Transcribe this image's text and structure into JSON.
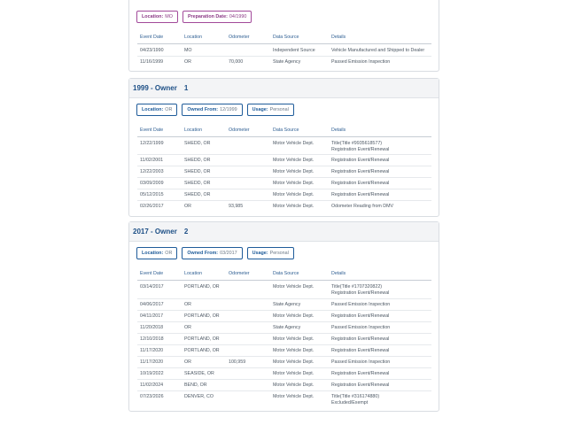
{
  "sections": [
    {
      "title": "",
      "owner": "",
      "chips": [
        {
          "label": "Location:",
          "value": "MO"
        },
        {
          "label": "Preparation Date:",
          "value": "04/1990"
        }
      ],
      "columns": [
        "Event Date",
        "Location",
        "Odometer",
        "Data Source",
        "Details"
      ],
      "rows": [
        {
          "date": "04/23/1990",
          "location": "MO",
          "odometer": "",
          "source": "Independent Source",
          "details": "Vehicle Manufactured and Shipped to Dealer"
        },
        {
          "date": "11/16/1999",
          "location": "OR",
          "odometer": "70,000",
          "source": "State Agency",
          "details": "Passed Emission Inspection"
        }
      ]
    },
    {
      "title": "1999 - Owner",
      "owner": "1",
      "chips": [
        {
          "label": "Location:",
          "value": "OR"
        },
        {
          "label": "Owned From:",
          "value": "12/1999"
        },
        {
          "label": "Usage:",
          "value": "Personal"
        }
      ],
      "columns": [
        "Event Date",
        "Location",
        "Odometer",
        "Data Source",
        "Details"
      ],
      "rows": [
        {
          "date": "12/22/1999",
          "location": "SHEDD, OR",
          "odometer": "",
          "source": "Motor Vehicle Dept.",
          "details": "Title(Title #9935618577)",
          "details2": "Registration Event/Renewal"
        },
        {
          "date": "11/02/2001",
          "location": "SHEDD, OR",
          "odometer": "",
          "source": "Motor Vehicle Dept.",
          "details": "Registration Event/Renewal"
        },
        {
          "date": "12/22/2003",
          "location": "SHEDD, OR",
          "odometer": "",
          "source": "Motor Vehicle Dept.",
          "details": "Registration Event/Renewal"
        },
        {
          "date": "03/09/2009",
          "location": "SHEDD, OR",
          "odometer": "",
          "source": "Motor Vehicle Dept.",
          "details": "Registration Event/Renewal"
        },
        {
          "date": "05/12/2015",
          "location": "SHEDD, OR",
          "odometer": "",
          "source": "Motor Vehicle Dept.",
          "details": "Registration Event/Renewal"
        },
        {
          "date": "02/26/2017",
          "location": "OR",
          "odometer": "93,985",
          "source": "Motor Vehicle Dept.",
          "details": "Odometer Reading from DMV"
        }
      ]
    },
    {
      "title": "2017 - Owner",
      "owner": "2",
      "chips": [
        {
          "label": "Location:",
          "value": "OR"
        },
        {
          "label": "Owned From:",
          "value": "03/2017"
        },
        {
          "label": "Usage:",
          "value": "Personal"
        }
      ],
      "columns": [
        "Event Date",
        "Location",
        "Odometer",
        "Data Source",
        "Details"
      ],
      "rows": [
        {
          "date": "03/14/2017",
          "location": "PORTLAND, OR",
          "odometer": "",
          "source": "Motor Vehicle Dept.",
          "details": "Title(Title #1707320822)",
          "details2": "Registration Event/Renewal"
        },
        {
          "date": "04/06/2017",
          "location": "OR",
          "odometer": "",
          "source": "State Agency",
          "details": "Passed Emission Inspection"
        },
        {
          "date": "04/11/2017",
          "location": "PORTLAND, OR",
          "odometer": "",
          "source": "Motor Vehicle Dept.",
          "details": "Registration Event/Renewal"
        },
        {
          "date": "11/20/2018",
          "location": "OR",
          "odometer": "",
          "source": "State Agency",
          "details": "Passed Emission Inspection"
        },
        {
          "date": "12/10/2018",
          "location": "PORTLAND, OR",
          "odometer": "",
          "source": "Motor Vehicle Dept.",
          "details": "Registration Event/Renewal"
        },
        {
          "date": "11/17/2020",
          "location": "PORTLAND, OR",
          "odometer": "",
          "source": "Motor Vehicle Dept.",
          "details": "Registration Event/Renewal"
        },
        {
          "date": "11/17/2020",
          "location": "OR",
          "odometer": "100,959",
          "source": "Motor Vehicle Dept.",
          "details": "Passed Emission Inspection"
        },
        {
          "date": "10/19/2022",
          "location": "SEASIDE, OR",
          "odometer": "",
          "source": "Motor Vehicle Dept.",
          "details": "Registration Event/Renewal"
        },
        {
          "date": "11/02/2024",
          "location": "BEND, OR",
          "odometer": "",
          "source": "Motor Vehicle Dept.",
          "details": "Registration Event/Renewal"
        },
        {
          "date": "07/23/2026",
          "location": "DENVER, CO",
          "odometer": "",
          "source": "Motor Vehicle Dept.",
          "details": "Title(Title #316174880)",
          "details2": "Excluded/Exempt"
        }
      ]
    }
  ],
  "colors": {
    "accent": "#1f5c9a",
    "chip_purple": "#a24a9a",
    "header_bg": "#f3f4f6"
  }
}
